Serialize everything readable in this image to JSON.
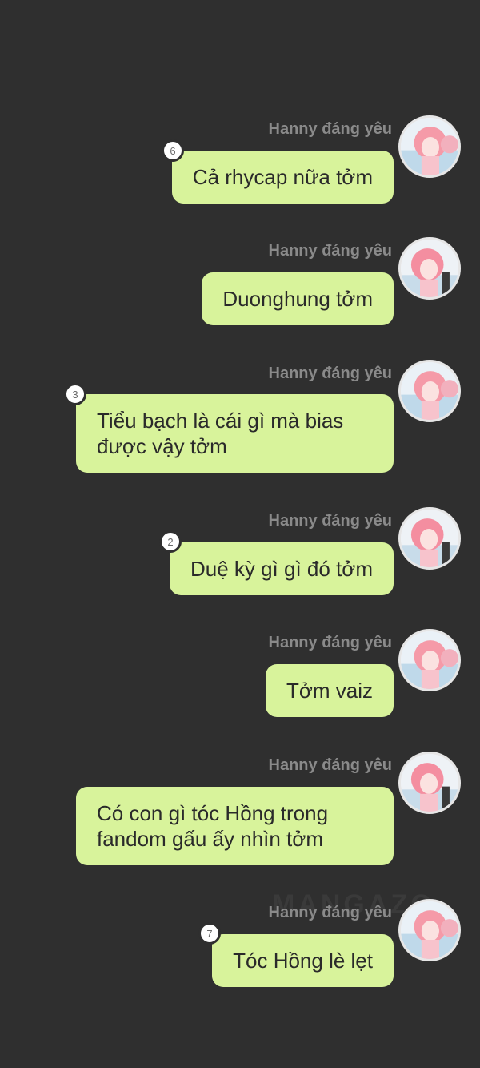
{
  "watermark": "MANGAZO",
  "messages": [
    {
      "sender": "Hanny đáng yêu",
      "text": "Cả rhycap nữa tởm",
      "badge": "6"
    },
    {
      "sender": "Hanny đáng yêu",
      "text": "Duonghung tởm",
      "badge": ""
    },
    {
      "sender": "Hanny đáng yêu",
      "text_line1": "Tiểu bạch là cái gì mà bias",
      "text_line2": "được vậy tởm",
      "badge": "3"
    },
    {
      "sender": "Hanny đáng yêu",
      "text": "Duệ kỳ gì gì đó tởm",
      "badge": "2"
    },
    {
      "sender": "Hanny đáng yêu",
      "text": "Tởm vaiz",
      "badge": ""
    },
    {
      "sender": "Hanny đáng yêu",
      "text_line1": "Có con gì tóc Hồng trong",
      "text_line2": "fandom gấu ấy nhìn tởm",
      "badge": ""
    },
    {
      "sender": "Hanny đáng yêu",
      "text": "Tóc Hồng lè lẹt",
      "badge": "7"
    }
  ]
}
